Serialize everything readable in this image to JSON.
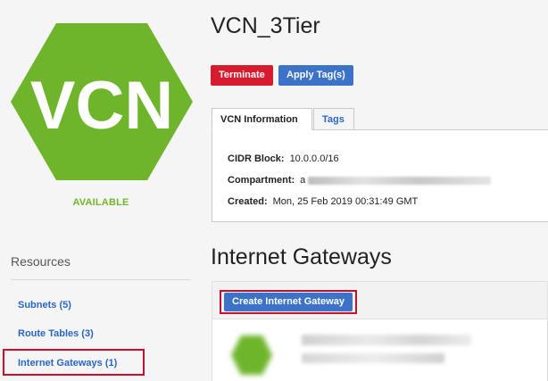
{
  "vcn": {
    "logo_text": "VCN",
    "status": "AVAILABLE",
    "title": "VCN_3Tier",
    "colors": {
      "logo_green": "#6fb52c",
      "status_green": "#72b52a",
      "danger": "#d71a2c",
      "primary": "#3c73c8",
      "link": "#2967c6",
      "highlight": "#c8102e"
    }
  },
  "actions": {
    "terminate": "Terminate",
    "apply_tags": "Apply Tag(s)"
  },
  "tabs": {
    "info": "VCN Information",
    "tags": "Tags"
  },
  "info": {
    "cidr_label": "CIDR Block:",
    "cidr_value": "10.0.0.0/16",
    "compartment_label": "Compartment:",
    "compartment_value_visible": "a",
    "created_label": "Created:",
    "created_value": "Mon, 25 Feb 2019 00:31:49 GMT"
  },
  "resources": {
    "title": "Resources",
    "items": [
      {
        "label": "Subnets (5)",
        "active": false
      },
      {
        "label": "Route Tables (3)",
        "active": false
      },
      {
        "label": "Internet Gateways (1)",
        "active": true
      }
    ]
  },
  "gateways": {
    "title": "Internet Gateways",
    "create_label": "Create Internet Gateway"
  }
}
